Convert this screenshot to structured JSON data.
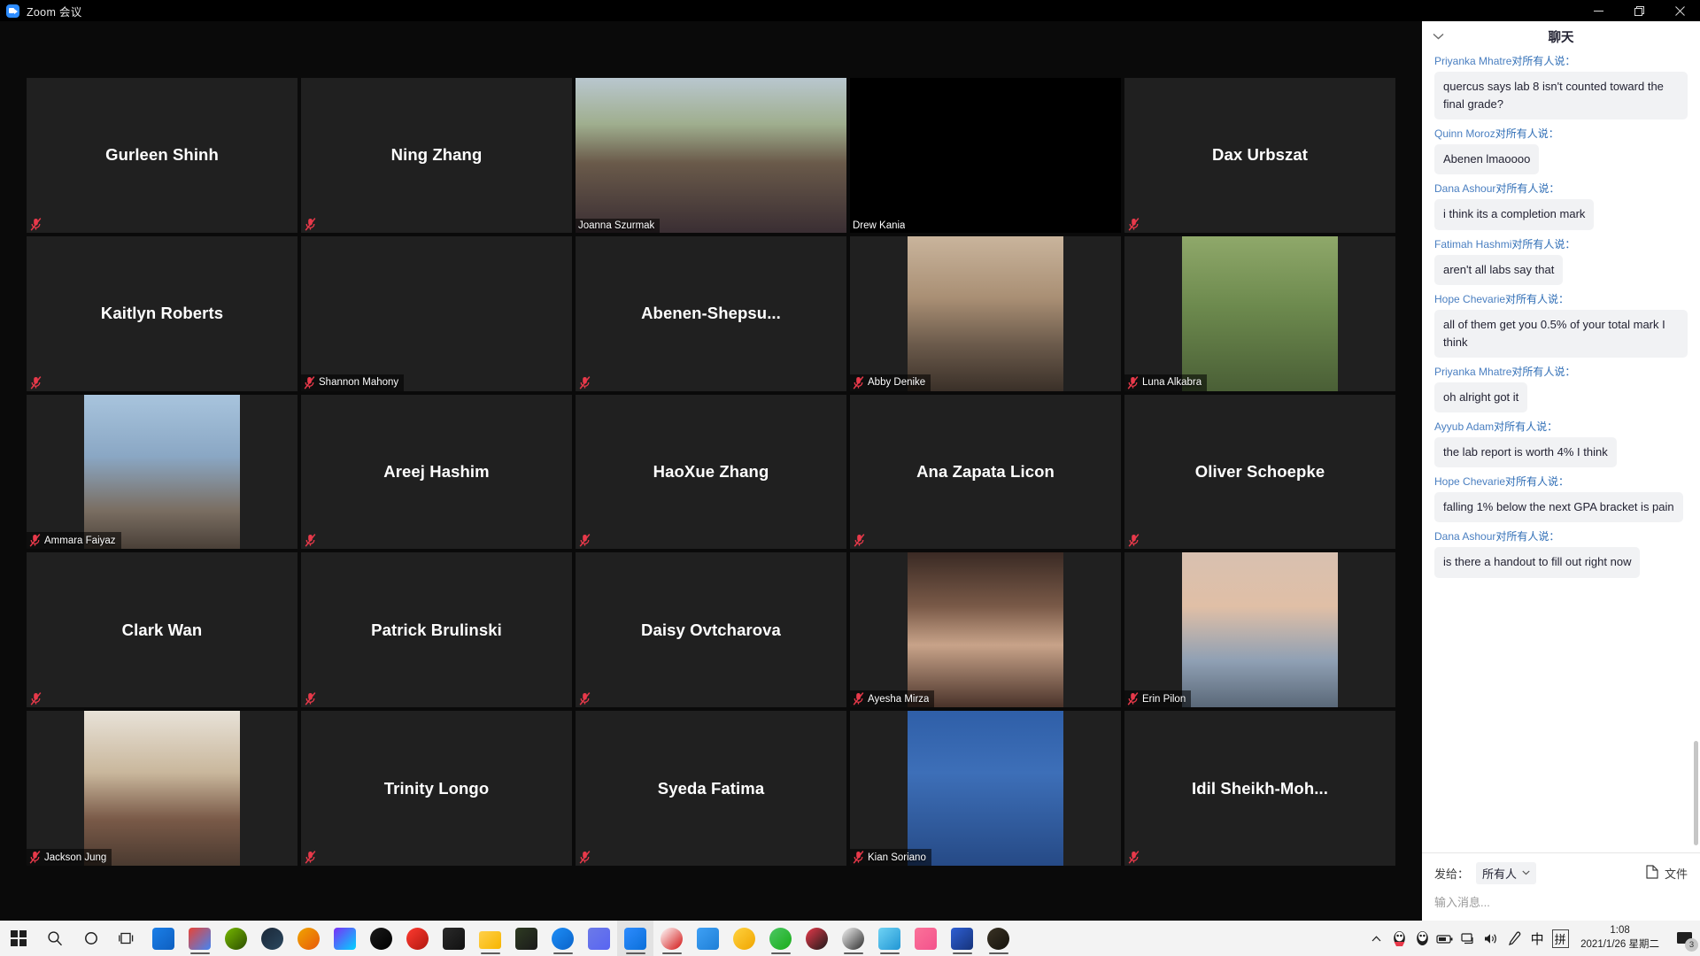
{
  "window": {
    "title": "Zoom 会议",
    "app_icon": "zoom-video-icon",
    "minimize_label": "最小化",
    "maximize_label": "最大化",
    "close_label": "关闭"
  },
  "meeting": {
    "tiles": [
      {
        "name": "Gurleen Shinh",
        "layout": "center",
        "video": false,
        "muted": true,
        "speaking": false,
        "bg": "#202020"
      },
      {
        "name": "Ning Zhang",
        "layout": "center",
        "video": false,
        "muted": true,
        "speaking": false,
        "bg": "#202020"
      },
      {
        "name": "Joanna Szurmak",
        "layout": "badge",
        "video": true,
        "muted": false,
        "speaking": true,
        "bg": "#202020"
      },
      {
        "name": "Drew Kania",
        "layout": "badge",
        "video": false,
        "muted": false,
        "speaking": false,
        "bg": "#000000"
      },
      {
        "name": "Dax Urbszat",
        "layout": "center",
        "video": false,
        "muted": true,
        "speaking": false,
        "bg": "#202020"
      },
      {
        "name": "Kaitlyn Roberts",
        "layout": "center",
        "video": false,
        "muted": true,
        "speaking": false,
        "bg": "#202020"
      },
      {
        "name": "Shannon Mahony",
        "layout": "badge",
        "video": false,
        "muted": true,
        "speaking": false,
        "bg": "#202020"
      },
      {
        "name": "Abenen-Shepsu...",
        "layout": "center",
        "video": false,
        "muted": true,
        "speaking": false,
        "bg": "#202020"
      },
      {
        "name": "Abby Denike",
        "layout": "badge",
        "video": true,
        "muted": true,
        "speaking": false,
        "bg": "#202020"
      },
      {
        "name": "Luna Alkabra",
        "layout": "badge",
        "video": true,
        "muted": true,
        "speaking": false,
        "bg": "#202020"
      },
      {
        "name": "Ammara Faiyaz",
        "layout": "badge",
        "video": true,
        "muted": true,
        "speaking": false,
        "bg": "#202020"
      },
      {
        "name": "Areej Hashim",
        "layout": "center",
        "video": false,
        "muted": true,
        "speaking": false,
        "bg": "#202020"
      },
      {
        "name": "HaoXue Zhang",
        "layout": "center",
        "video": false,
        "muted": true,
        "speaking": false,
        "bg": "#202020"
      },
      {
        "name": "Ana Zapata Licon",
        "layout": "center",
        "video": false,
        "muted": true,
        "speaking": false,
        "bg": "#202020"
      },
      {
        "name": "Oliver Schoepke",
        "layout": "center",
        "video": false,
        "muted": true,
        "speaking": false,
        "bg": "#202020"
      },
      {
        "name": "Clark Wan",
        "layout": "center",
        "video": false,
        "muted": true,
        "speaking": false,
        "bg": "#202020"
      },
      {
        "name": "Patrick Brulinski",
        "layout": "center",
        "video": false,
        "muted": true,
        "speaking": false,
        "bg": "#202020"
      },
      {
        "name": "Daisy Ovtcharova",
        "layout": "center",
        "video": false,
        "muted": true,
        "speaking": false,
        "bg": "#202020"
      },
      {
        "name": "Ayesha Mirza",
        "layout": "badge",
        "video": true,
        "muted": true,
        "speaking": false,
        "bg": "#202020"
      },
      {
        "name": "Erin Pilon",
        "layout": "badge",
        "video": true,
        "muted": true,
        "speaking": false,
        "bg": "#202020"
      },
      {
        "name": "Jackson Jung",
        "layout": "badge",
        "video": true,
        "muted": true,
        "speaking": false,
        "bg": "#202020"
      },
      {
        "name": "Trinity Longo",
        "layout": "center",
        "video": false,
        "muted": true,
        "speaking": false,
        "bg": "#202020"
      },
      {
        "name": "Syeda Fatima",
        "layout": "center",
        "video": false,
        "muted": true,
        "speaking": false,
        "bg": "#202020"
      },
      {
        "name": "Kian Soriano",
        "layout": "badge",
        "video": true,
        "muted": true,
        "speaking": false,
        "bg": "#202020"
      },
      {
        "name": "Idil  Sheikh-Moh...",
        "layout": "center",
        "video": false,
        "muted": true,
        "speaking": false,
        "bg": "#202020"
      }
    ],
    "speaking_border_color": "#b5e853",
    "mute_icon_color": "#e8394a"
  },
  "chat": {
    "title": "聊天",
    "collapse_icon": "chevron-down-icon",
    "to_all_suffix": "对所有人说：",
    "messages": [
      {
        "from": "Priyanka Mhatre",
        "text": "quercus says lab 8 isn't counted toward the final grade?"
      },
      {
        "from": "Quinn Moroz",
        "text": "Abenen lmaoooo"
      },
      {
        "from": "Dana Ashour",
        "text": "i think its a completion mark"
      },
      {
        "from": "Fatimah Hashmi",
        "text": "aren't all labs say that"
      },
      {
        "from": "Hope Chevarie",
        "text": "all of them get you 0.5% of your total mark I think"
      },
      {
        "from": "Priyanka Mhatre",
        "text": "oh alright got it"
      },
      {
        "from": "Ayyub Adam",
        "text": "the lab report is worth 4% I think"
      },
      {
        "from": "Hope Chevarie",
        "text": "falling 1% below the next GPA bracket is pain"
      },
      {
        "from": "Dana Ashour",
        "text": "is there a handout to fill out right now"
      }
    ],
    "footer": {
      "send_to_label": "发给：",
      "send_to_value": "所有人",
      "send_to_caret": "chevron-down-icon",
      "file_label": "文件",
      "file_icon": "file-icon",
      "input_placeholder": "输入消息..."
    }
  },
  "taskbar": {
    "start_label": "开始",
    "search_label": "搜索",
    "cortana_label": "Cortana",
    "taskview_label": "任务视图",
    "apps": [
      {
        "name": "app-360-safe",
        "color1": "#1b7fe8",
        "color2": "#0e5fc0",
        "shape": "shield",
        "running": false
      },
      {
        "name": "app-google-chrome",
        "color1": "#ea4335",
        "color2": "#4285f4",
        "shape": "chrome",
        "running": true
      },
      {
        "name": "app-nvidia-green",
        "color1": "#76b900",
        "color2": "#2b4d00",
        "shape": "round",
        "running": false
      },
      {
        "name": "app-steam",
        "color1": "#1b2838",
        "color2": "#2a475e",
        "shape": "round",
        "running": false
      },
      {
        "name": "app-lenovo",
        "color1": "#f0a500",
        "color2": "#e8590c",
        "shape": "round",
        "running": false
      },
      {
        "name": "app-gamepp",
        "color1": "#7b2ff7",
        "color2": "#00d4ff",
        "shape": "square",
        "running": false
      },
      {
        "name": "app-logitech-g",
        "color1": "#1a1a1a",
        "color2": "#000000",
        "shape": "round",
        "running": false
      },
      {
        "name": "app-opera-gx",
        "color1": "#ff3b30",
        "color2": "#b0170f",
        "shape": "round",
        "running": false
      },
      {
        "name": "app-epic-games",
        "color1": "#2a2a2a",
        "color2": "#111111",
        "shape": "square",
        "running": false
      },
      {
        "name": "app-file-explorer",
        "color1": "#ffd04b",
        "color2": "#f7b500",
        "shape": "folder",
        "running": true
      },
      {
        "name": "app-nvidia",
        "color1": "#2e3b22",
        "color2": "#1a1a1a",
        "shape": "square",
        "running": false
      },
      {
        "name": "app-qq-browser",
        "color1": "#1e8ef7",
        "color2": "#0a63c9",
        "shape": "round",
        "running": true
      },
      {
        "name": "app-discord",
        "color1": "#6c7ae8",
        "color2": "#5865f2",
        "shape": "square",
        "running": false
      },
      {
        "name": "app-zoom",
        "color1": "#2d8cff",
        "color2": "#0b6fd8",
        "shape": "square",
        "running": true
      },
      {
        "name": "app-obs-studio",
        "color1": "#ffffff",
        "color2": "#d21313",
        "shape": "round",
        "running": true
      },
      {
        "name": "app-flight-blue",
        "color1": "#3ea0f5",
        "color2": "#1f7fd6",
        "shape": "square",
        "running": false
      },
      {
        "name": "app-qq-music",
        "color1": "#ffd23f",
        "color2": "#f0a500",
        "shape": "round",
        "running": false
      },
      {
        "name": "app-wechat",
        "color1": "#4cc764",
        "color2": "#1aad19",
        "shape": "round",
        "running": true
      },
      {
        "name": "app-qq-penguin-1",
        "color1": "#e8394a",
        "color2": "#1a1a1a",
        "shape": "round",
        "running": false
      },
      {
        "name": "app-qq-penguin-2",
        "color1": "#f5f5f5",
        "color2": "#2b2b2b",
        "shape": "round",
        "running": true
      },
      {
        "name": "app-sky-blue",
        "color1": "#6fd3f5",
        "color2": "#2196d4",
        "shape": "square",
        "running": true
      },
      {
        "name": "app-bilibili",
        "color1": "#fb7299",
        "color2": "#f3528c",
        "shape": "square",
        "running": false
      },
      {
        "name": "app-game-blue",
        "color1": "#2e5fd4",
        "color2": "#16337a",
        "shape": "square",
        "running": true
      },
      {
        "name": "app-game-dark",
        "color1": "#3a3325",
        "color2": "#15120c",
        "shape": "round",
        "running": true
      }
    ],
    "tray": {
      "overflow_icon": "chevron-up-icon",
      "icons": [
        "qq-penguin-icon",
        "qq-penguin-icon",
        "battery-icon",
        "network-icon",
        "volume-icon",
        "pen-icon"
      ],
      "ime_mode": "中",
      "ime_pinyin": "拼",
      "time": "1:08",
      "date": "2021/1/26 星期二",
      "notification_icon": "notification-icon",
      "notification_count": "3"
    }
  }
}
